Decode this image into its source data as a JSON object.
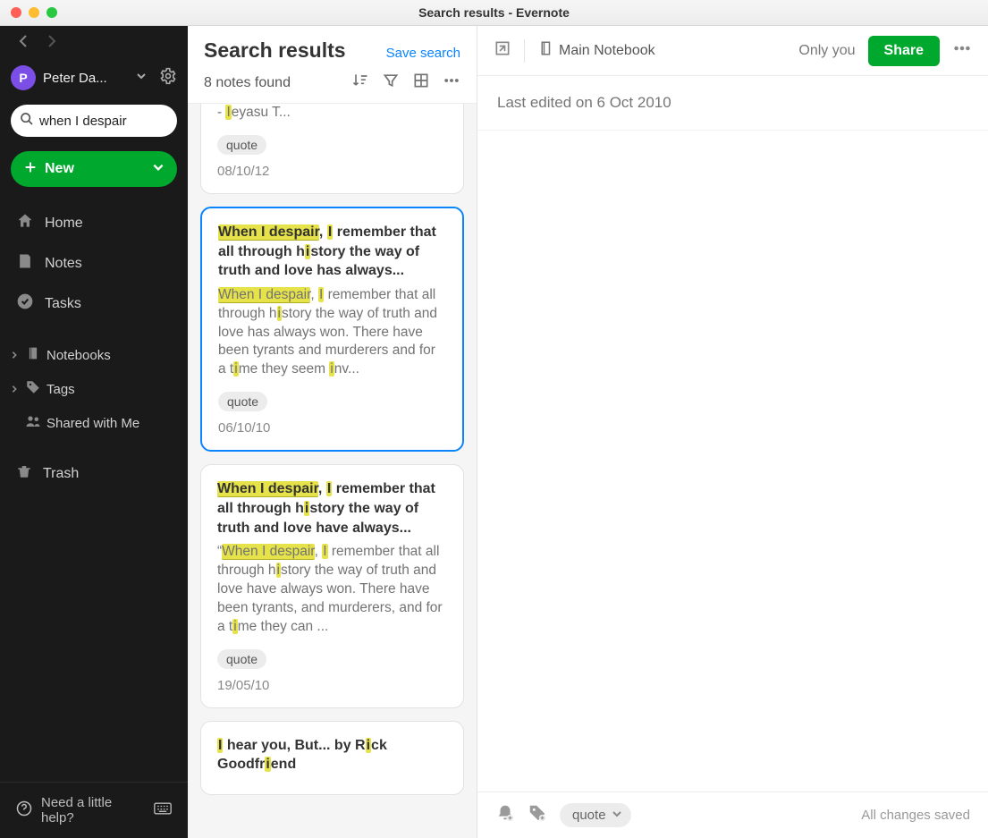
{
  "window": {
    "title": "Search results - Evernote"
  },
  "sidebar": {
    "user": {
      "initial": "P",
      "name": "Peter Da..."
    },
    "search": {
      "value": "when I despair"
    },
    "new_label": "New",
    "items": [
      {
        "label": "Home"
      },
      {
        "label": "Notes"
      },
      {
        "label": "Tasks"
      }
    ],
    "sections": [
      {
        "label": "Notebooks"
      },
      {
        "label": "Tags"
      },
      {
        "label": "Shared with Me"
      }
    ],
    "trash_label": "Trash",
    "help_label": "Need a little help?"
  },
  "midcol": {
    "title": "Search results",
    "save_search": "Save search",
    "notes_found": "8 notes found"
  },
  "cards": [
    {
      "trailing": "eyasu T...",
      "tag": "quote",
      "date": "08/10/12"
    },
    {
      "title_hl": "When I despair",
      "title_mid1": ", ",
      "title_i": "I",
      "title_rest1": " remember that all through h",
      "title_i2": "i",
      "title_rest2": "story the way of truth and love has always...",
      "snip_hl": "When I despair",
      "snip_mid1": ", ",
      "snip_i": "I",
      "snip_rest1": " remember that all through h",
      "snip_i2": "i",
      "snip_rest2": "story the way of truth and love has always won. There have been tyrants and murderers and for a t",
      "snip_i3": "i",
      "snip_rest3": "me they seem ",
      "snip_i4": "i",
      "snip_rest4": "nv...",
      "tag": "quote",
      "date": "06/10/10"
    },
    {
      "title_hl": "When I despair",
      "title_mid1": ", ",
      "title_i": "I",
      "title_rest1": " remember that all through h",
      "title_i2": "i",
      "title_rest2": "story the way of truth and love have always...",
      "snip_pre": "“",
      "snip_hl": "When I despair",
      "snip_mid1": ", ",
      "snip_i": "I",
      "snip_rest1": " remember that all through h",
      "snip_i2": "i",
      "snip_rest2": "story the way of truth and love have always won. There have been tyrants, and murderers, and for a t",
      "snip_i3": "i",
      "snip_rest3": "me they can ...",
      "tag": "quote",
      "date": "19/05/10"
    },
    {
      "title_a": "I",
      "title_b": " hear you, But... by R",
      "title_c": "i",
      "title_d": "ck Goodfr",
      "title_e": "i",
      "title_f": "end"
    }
  ],
  "right": {
    "notebook": "Main Notebook",
    "only_you": "Only you",
    "share": "Share",
    "last_edited": "Last edited on 6 Oct 2010",
    "footer_tag": "quote",
    "saved": "All changes saved"
  }
}
